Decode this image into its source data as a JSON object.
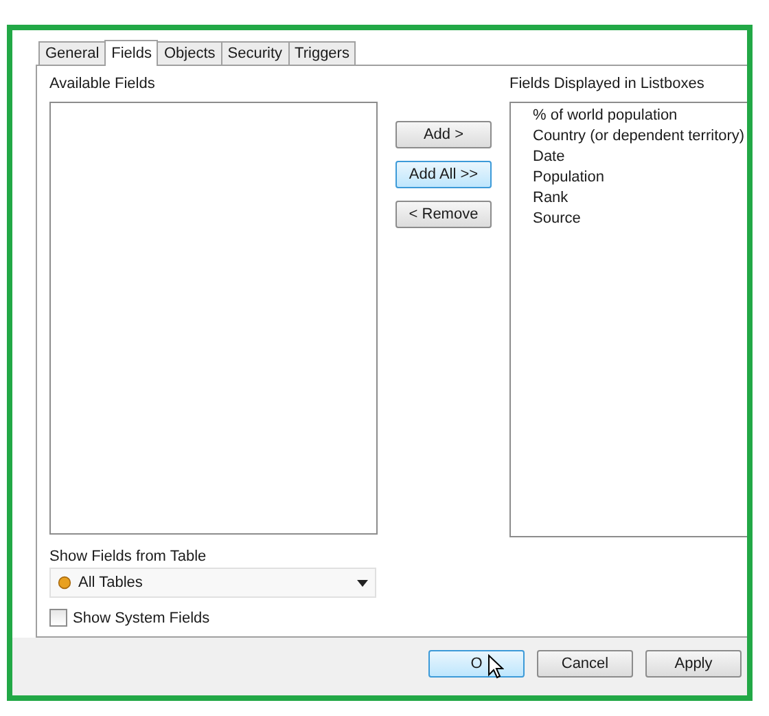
{
  "tabs": [
    {
      "label": "General",
      "selected": false
    },
    {
      "label": "Fields",
      "selected": true
    },
    {
      "label": "Objects",
      "selected": false
    },
    {
      "label": "Security",
      "selected": false
    },
    {
      "label": "Triggers",
      "selected": false
    }
  ],
  "available_fields": {
    "label": "Available Fields"
  },
  "move_buttons": [
    {
      "label": "Add >",
      "highlighted": false
    },
    {
      "label": "Add All >>",
      "highlighted": true
    },
    {
      "label": "< Remove",
      "highlighted": false
    }
  ],
  "displayed_fields": {
    "label": "Fields Displayed in Listboxes",
    "items": [
      "% of world population",
      "Country (or dependent territory)",
      "Date",
      "Population",
      "Rank",
      "Source"
    ]
  },
  "table_filter": {
    "label": "Show Fields from Table",
    "value": "All Tables"
  },
  "system_fields": {
    "label": "Show System Fields",
    "checked": false
  },
  "dialog_buttons": [
    {
      "label": "O",
      "highlighted": true,
      "pointer": true
    },
    {
      "label": "Cancel",
      "highlighted": false,
      "pointer": false
    },
    {
      "label": "Apply",
      "highlighted": false,
      "pointer": false
    }
  ]
}
